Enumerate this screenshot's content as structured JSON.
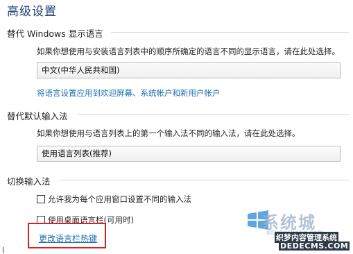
{
  "page": {
    "title": "高级设置"
  },
  "display_language": {
    "heading": "替代 Windows 显示语言",
    "description": "如果你想使用与安装语言列表中的顺序所确定的语言不同的显示语言，请在此处选择。",
    "selected": "中文(中华人民共和国)",
    "apply_link": "将语言设置应用到欢迎屏幕、系统帐户和新用户帐户"
  },
  "input_method": {
    "heading": "替代默认输入法",
    "description": "如果你想使用与语言列表上的第一个输入法不同的输入法，请在此处选择。",
    "selected": "使用语言列表(推荐)"
  },
  "switch_input": {
    "heading": "切换输入法",
    "options": [
      {
        "label": "允许我为每个应用窗口设置不同的输入法",
        "checked": false
      },
      {
        "label": "使用桌面语言栏(可用时)",
        "checked": false
      }
    ],
    "hotkey_link": "更改语言栏热键"
  },
  "watermark": {
    "brand": "系统城",
    "site": "xitongcheng.com",
    "line1": "织梦内容管理系统",
    "line2": "DEDECMS.COM"
  },
  "colors": {
    "highlight_border": "#e01e1e",
    "link": "#1a6fb3",
    "title": "#1f3f73"
  }
}
